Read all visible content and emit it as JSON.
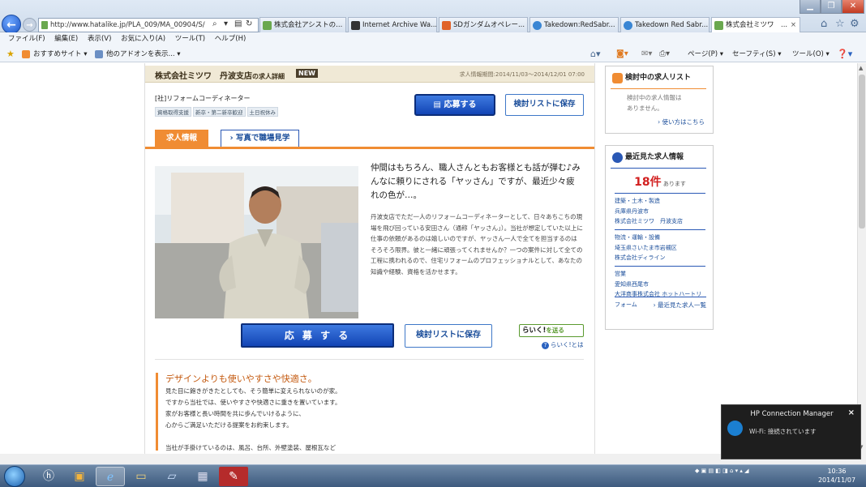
{
  "browser": {
    "address": "http://www.hatalike.jp/PLA_009/MA_00904/S/",
    "tabs": [
      {
        "label": "株式会社アシストの..."
      },
      {
        "label": "Internet Archive Wa..."
      },
      {
        "label": "SDガンダムオペレー..."
      },
      {
        "label": "Takedown:RedSabr..."
      },
      {
        "label": "Takedown Red Sabr..."
      },
      {
        "label": "株式会社ミツワ　..."
      }
    ],
    "tab_close": "×",
    "menu": [
      "ファイル(F)",
      "編集(E)",
      "表示(V)",
      "お気に入り(A)",
      "ツール(T)",
      "ヘルプ(H)"
    ],
    "favorites": [
      "おすすめサイト ▾",
      "他のアドオンを表示... ▾"
    ],
    "cmdbar": [
      "ページ(P) ▾",
      "セーフティ(S) ▾",
      "ツール(O) ▾"
    ]
  },
  "job": {
    "company": "株式会社ミツワ　丹波支店",
    "company_suffix": "の求人詳細",
    "new_badge": "NEW",
    "period": "求人情報期間:2014/11/03〜2014/12/01 07:00",
    "title": "[社]リフォームコーディネーター",
    "tags": [
      "資格取得支援",
      "新卒・第二新卒歓迎",
      "土日祝休み"
    ],
    "apply_label": "応募する",
    "save_label": "検討リストに保存",
    "tab_info": "求人情報",
    "tab_photos": "写真で職場見学",
    "headline": "仲間はもちろん、職人さんともお客様とも話が弾む♪みんなに頼りにされる「ヤッさん」ですが、最近少々疲れの色が…。",
    "body": "丹波支店でただ一人のリフォームコーディネーターとして、日々あちこちの現場を飛び回っている安田さん（通称「ヤッさん」）。当社が想定していた以上に仕事の依頼があるのは嬉しいのですが、ヤッさん一人で全てを担当するのはそろそろ限界。彼と一緒に頑張ってくれませんか？一つの案件に対して全ての工程に携われるので、住宅リフォームのプロフェッショナルとして、あなたの知識や経験、資格を活かせます。",
    "apply_label_large": "応 募 す る",
    "raiku_label": "らいく!",
    "raiku_suffix": "を送る",
    "raiku_help": "らいく!とは",
    "section_title": "デザインよりも使いやすさや快適さ。",
    "section_body": [
      "見た目に飽きがきたとしても、そう簡単に変えられないのが家。",
      "ですから当社では、使いやすさや快適さに重きを置いています。",
      "家がお客様と長い時間を共に歩んでいけるように、",
      "心からご満足いただける提案をお約束します。",
      "",
      "当社が手掛けているのは、風呂、台所、外壁塗装、屋根瓦など"
    ]
  },
  "sidebar": {
    "pending_title": "検討中の求人リスト",
    "pending_empty": [
      "検討中の求人情報は",
      "ありません。"
    ],
    "pending_link": "› 使い方はこちら",
    "recent_title": "最近見た求人情報",
    "recent_count": "18件",
    "recent_count_suffix": "あります",
    "recent": [
      {
        "category": "建築・土木・製造",
        "location": "兵庫県丹波市",
        "company": "株式会社ミツワ　丹波支店"
      },
      {
        "category": "物流・運輸・設備",
        "location": "埼玉県さいたま市岩槻区",
        "company": "株式会社ディライン"
      },
      {
        "category": "営業",
        "location": "愛知県西尾市",
        "company": "大洋商事株式会社 ホットハートリフォーム"
      }
    ],
    "recent_link": "› 最近見た求人一覧"
  },
  "taskbar": {
    "time": "10:36",
    "date": "2014/11/07"
  },
  "notification": {
    "title": "HP Connection Manager",
    "message": "Wi-Fi: 接続されています",
    "close": "×"
  }
}
